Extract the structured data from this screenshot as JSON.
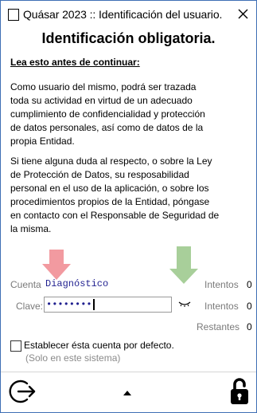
{
  "window": {
    "title": "Quásar 2023 :: Identificación del usuario."
  },
  "content": {
    "heading": "Identificación obligatoria.",
    "read_first": "Lea esto antes de continuar:",
    "paragraph1": "  Como usuario del mismo, podrá ser trazada\ntoda su actividad en virtud de un adecuado\ncumplimiento de confidencialidad y protección\nde datos personales, así como de datos de la\npropia Entidad.",
    "paragraph2": "  Si tiene alguna duda al respecto, o sobre la Ley\nde Protección de Datos, su resposabilidad\npersonal en el uso de la aplicación, o sobre los\nprocedimientos propios de la Entidad, póngase\nen contacto con el Responsable de Seguridad de\nla misma."
  },
  "form": {
    "account_label": "Cuenta",
    "account_value": "Diagnóstico",
    "password_label": "Clave:",
    "password_value": "••••••••",
    "attempts_label_1": "Intentos",
    "attempts_value_1": "0",
    "attempts_label_2": "Intentos",
    "attempts_value_2": "0",
    "remaining_label": "Restantes",
    "remaining_value": "0",
    "default_account_label": "Establecer ésta cuenta por defecto.",
    "default_account_note": "(Solo en este sistema)"
  },
  "icons": {
    "close": "close-icon",
    "show_password": "eye-closed-icon",
    "exit": "exit-icon",
    "collapse": "chevron-up-icon",
    "lock": "padlock-icon"
  },
  "colors": {
    "window_border": "#3f6fb5",
    "input_text": "#1f1f8f",
    "hint_red": "#f29aa0",
    "hint_green": "#a8cf9a"
  }
}
